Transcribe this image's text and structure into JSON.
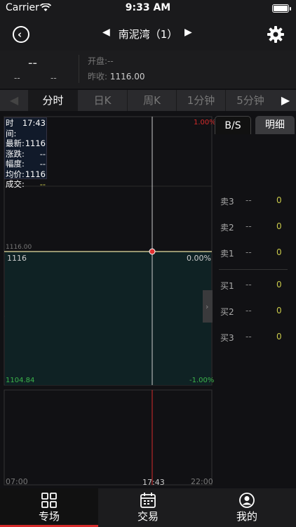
{
  "status_bar": {
    "carrier": "Carrier",
    "time": "9:33 AM"
  },
  "nav": {
    "title": "南泥湾（1）"
  },
  "quote": {
    "price": "--",
    "change": "--",
    "change_pct": "--",
    "open_label": "开盘:",
    "open_value": "--",
    "prev_close_label": "昨收:",
    "prev_close_value": "1116.00"
  },
  "tabs": [
    "分时",
    "日K",
    "周K",
    "1分钟",
    "5分钟"
  ],
  "info_box": [
    {
      "label": "时间:",
      "value": "17:43"
    },
    {
      "label": "最新:",
      "value": "1116"
    },
    {
      "label": "涨跌:",
      "value": "--"
    },
    {
      "label": "幅度:",
      "value": "--"
    },
    {
      "label": "均价:",
      "value": "1116"
    },
    {
      "label": "成交:",
      "value": "--"
    }
  ],
  "chart": {
    "y_top_pct": "1.00%",
    "y_mid_price": "1116.00",
    "y_mid_price_label": "1116",
    "y_mid_pct": "0.00%",
    "y_bottom_price": "1104.84",
    "y_bottom_pct": "-1.00%",
    "x_start": "07:00",
    "x_cursor": "17:43",
    "x_end": "22:00",
    "colors": {
      "up": "#d52b2b",
      "down": "#3cb44b",
      "price_line": "#e8e0a0"
    }
  },
  "panel": {
    "tabs": [
      "B/S",
      "明细"
    ],
    "sell": [
      {
        "name": "卖3",
        "price": "--",
        "volume": "0"
      },
      {
        "name": "卖2",
        "price": "--",
        "volume": "0"
      },
      {
        "name": "卖1",
        "price": "--",
        "volume": "0"
      }
    ],
    "buy": [
      {
        "name": "买1",
        "price": "--",
        "volume": "0"
      },
      {
        "name": "买2",
        "price": "--",
        "volume": "0"
      },
      {
        "name": "买3",
        "price": "--",
        "volume": "0"
      }
    ]
  },
  "bottom_tabs": [
    {
      "label": "专场",
      "icon": "grid-icon"
    },
    {
      "label": "交易",
      "icon": "calendar-icon"
    },
    {
      "label": "我的",
      "icon": "user-icon"
    }
  ]
}
